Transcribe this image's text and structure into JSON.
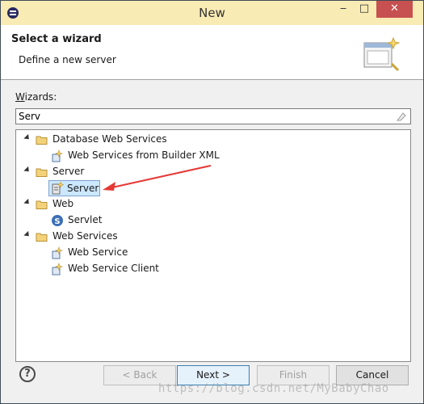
{
  "window": {
    "title": "New",
    "minimize_glyph": "‒",
    "maximize_glyph": "□",
    "close_glyph": "✕"
  },
  "banner": {
    "title": "Select a wizard",
    "description": "Define a new server",
    "art_icon": "wizard-banner-icon"
  },
  "wizards": {
    "label_prefix": "W",
    "label_rest": "izards:",
    "filter_value": "Serv",
    "clear_icon": "eraser-icon"
  },
  "tree": {
    "rows": [
      {
        "label": "Database Web Services",
        "kind": "folder",
        "expanded": true,
        "level": 0
      },
      {
        "label": "Web Services from Builder XML",
        "kind": "wizard",
        "level": 1
      },
      {
        "label": "Server",
        "kind": "folder",
        "expanded": true,
        "level": 0
      },
      {
        "label": "Server",
        "kind": "wizard-server",
        "level": 1,
        "selected": true
      },
      {
        "label": "Web",
        "kind": "folder",
        "expanded": true,
        "level": 0
      },
      {
        "label": "Servlet",
        "kind": "servlet",
        "level": 1
      },
      {
        "label": "Web Services",
        "kind": "folder",
        "expanded": true,
        "level": 0
      },
      {
        "label": "Web Service",
        "kind": "wizard",
        "level": 1
      },
      {
        "label": "Web Service Client",
        "kind": "wizard",
        "level": 1
      }
    ]
  },
  "buttons": {
    "help": "?",
    "back": "< Back",
    "next": "Next >",
    "finish": "Finish",
    "cancel": "Cancel"
  },
  "watermark": "https://blog.csdn.net/MyBabyChao",
  "colors": {
    "title_bar": "#f8ebb4",
    "close_button": "#c75050",
    "selection": "#cce8ff",
    "annotation_arrow": "#e53935"
  }
}
